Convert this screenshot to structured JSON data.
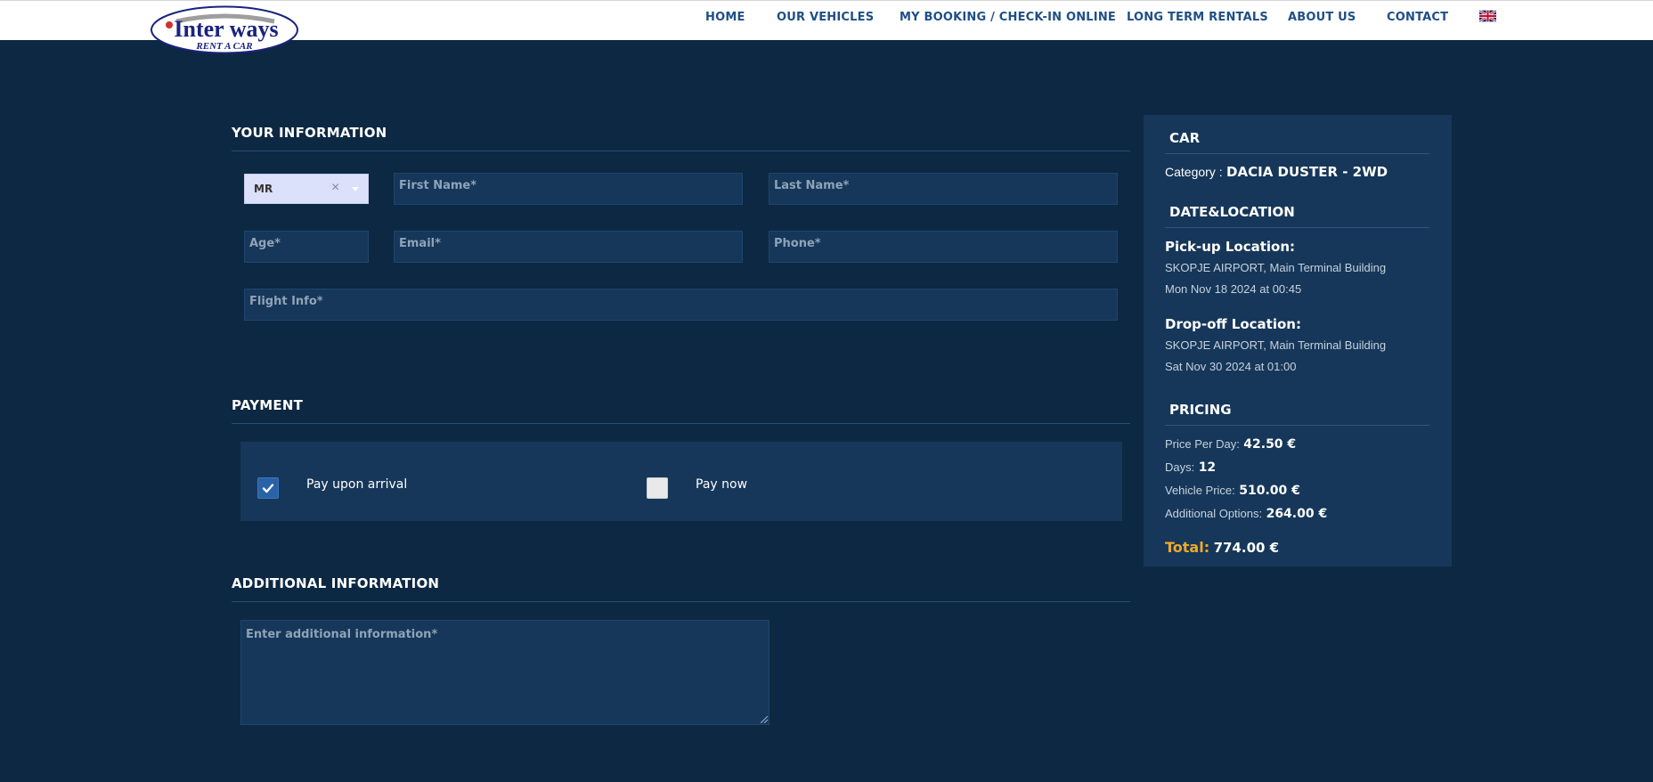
{
  "header": {
    "logo_text": "Inter ways",
    "logo_sub": "RENT A CAR",
    "nav": [
      {
        "label": "HOME"
      },
      {
        "label": "OUR VEHICLES"
      },
      {
        "label": "MY BOOKING / CHECK-IN ONLINE"
      },
      {
        "label": "LONG TERM RENTALS"
      },
      {
        "label": "ABOUT US"
      },
      {
        "label": "CONTACT"
      }
    ],
    "flag_icon": "uk-flag-icon"
  },
  "your_info": {
    "title": "YOUR INFORMATION",
    "salutation": "MR",
    "clear_glyph": "×",
    "first_name_placeholder": "First Name*",
    "last_name_placeholder": "Last Name*",
    "age_placeholder": "Age*",
    "email_placeholder": "Email*",
    "phone_placeholder": "Phone*",
    "flight_placeholder": "Flight Info*"
  },
  "payment": {
    "title": "PAYMENT",
    "options": [
      {
        "label": "Pay upon arrival",
        "checked": true
      },
      {
        "label": "Pay now",
        "checked": false
      }
    ]
  },
  "additional": {
    "title": "ADDITIONAL INFORMATION",
    "placeholder": "Enter additional information*"
  },
  "summary": {
    "car": {
      "title": "CAR",
      "category_label": "Category :",
      "category_value": "DACIA DUSTER - 2WD"
    },
    "date_location": {
      "title": "DATE&LOCATION",
      "pickup_label": "Pick-up Location:",
      "pickup_place": "SKOPJE AIRPORT, Main Terminal Building",
      "pickup_time": "Mon Nov 18 2024 at 00:45",
      "dropoff_label": "Drop-off Location:",
      "dropoff_place": "SKOPJE AIRPORT, Main Terminal Building",
      "dropoff_time": "Sat Nov 30 2024 at 01:00"
    },
    "pricing": {
      "title": "PRICING",
      "price_per_day_label": "Price Per Day:",
      "price_per_day": "42.50 €",
      "days_label": "Days:",
      "days": "12",
      "vehicle_price_label": "Vehicle Price:",
      "vehicle_price": "510.00 €",
      "options_label": "Additional Options:",
      "options_price": "264.00 €",
      "total_label": "Total:",
      "total": "774.00 €"
    }
  },
  "colors": {
    "background": "#0d2842",
    "panel": "#163759",
    "nav_text": "#1f4f86",
    "total_accent": "#f0a92b"
  }
}
